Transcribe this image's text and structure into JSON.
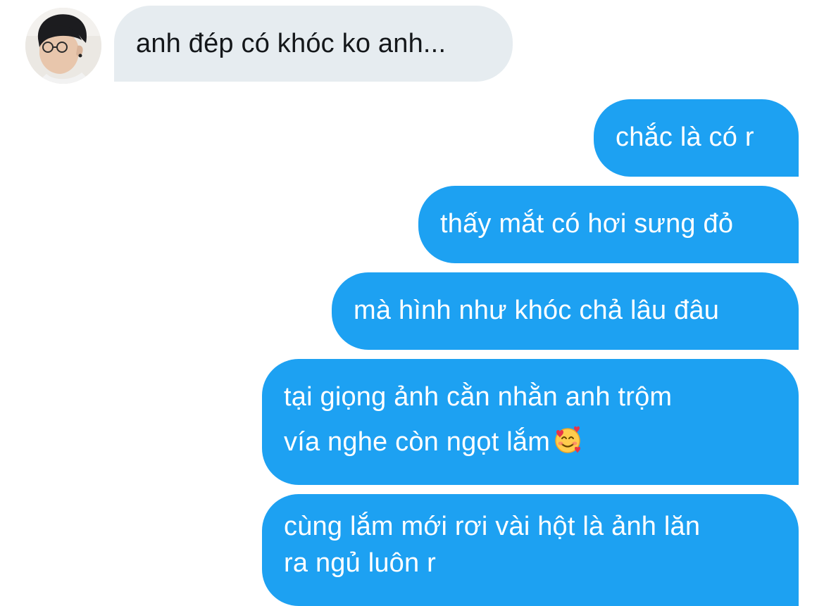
{
  "contact": {
    "avatar_icon": "user-avatar-photo"
  },
  "messages": [
    {
      "direction": "incoming",
      "text": "anh đép có khóc ko anh..."
    },
    {
      "direction": "outgoing",
      "text": "chắc là có r"
    },
    {
      "direction": "outgoing",
      "text": "thấy mắt có hơi sưng đỏ"
    },
    {
      "direction": "outgoing",
      "text": "mà hình như khóc chả lâu đâu"
    },
    {
      "direction": "outgoing",
      "lines": [
        "tại giọng ảnh cằn nhằn anh trộm",
        "vía nghe còn ngọt lắm"
      ],
      "emoji": "smiling-face-with-hearts-icon"
    },
    {
      "direction": "outgoing",
      "lines": [
        "cùng lắm mới rơi vài hột là ảnh lăn",
        "ra ngủ luôn r"
      ]
    }
  ],
  "colors": {
    "incoming_bubble": "#e6ecf0",
    "outgoing_bubble": "#1da1f2",
    "incoming_text": "#14171a",
    "outgoing_text": "#ffffff"
  }
}
